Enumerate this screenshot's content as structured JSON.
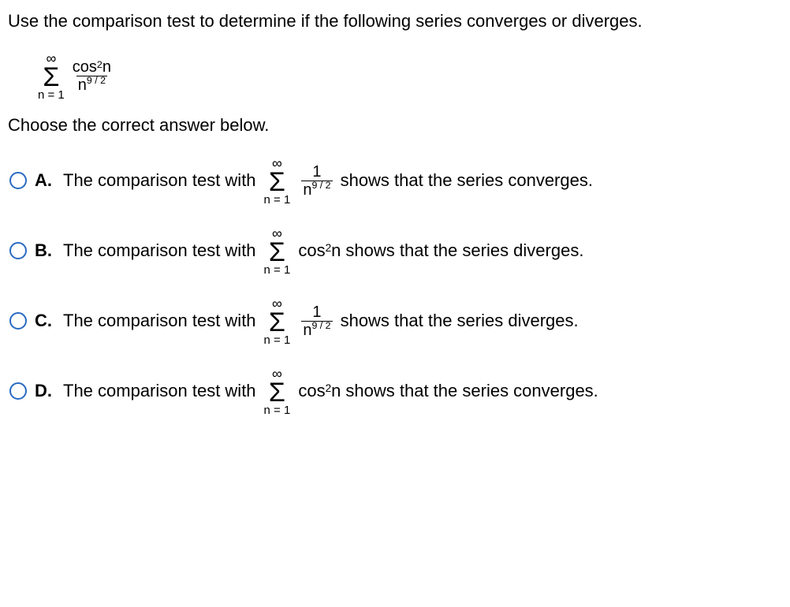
{
  "question": "Use the comparison test to determine if the following series converges or diverges.",
  "series_main": {
    "top": "∞",
    "sigma": "Σ",
    "bottom": "n = 1",
    "frac_num_base": "cos ",
    "frac_num_exp": "2",
    "frac_num_tail": "n",
    "frac_den_base": "n",
    "frac_den_exp": "9 / 2"
  },
  "instruction": "Choose the correct answer below.",
  "common": {
    "lead": "The comparison test with ",
    "sigma_top": "∞",
    "sigma": "Σ",
    "sigma_bottom": "n = 1",
    "frac_num": "1",
    "frac_den_base": "n",
    "frac_den_exp": "9 / 2",
    "cos_base": "cos ",
    "cos_exp": "2",
    "cos_tail": "n"
  },
  "options": {
    "A": {
      "label": "A.",
      "tail": " shows that the series converges."
    },
    "B": {
      "label": "B.",
      "tail": " shows that the series diverges."
    },
    "C": {
      "label": "C.",
      "tail": " shows that the series diverges."
    },
    "D": {
      "label": "D.",
      "tail": " shows that the series converges."
    }
  }
}
